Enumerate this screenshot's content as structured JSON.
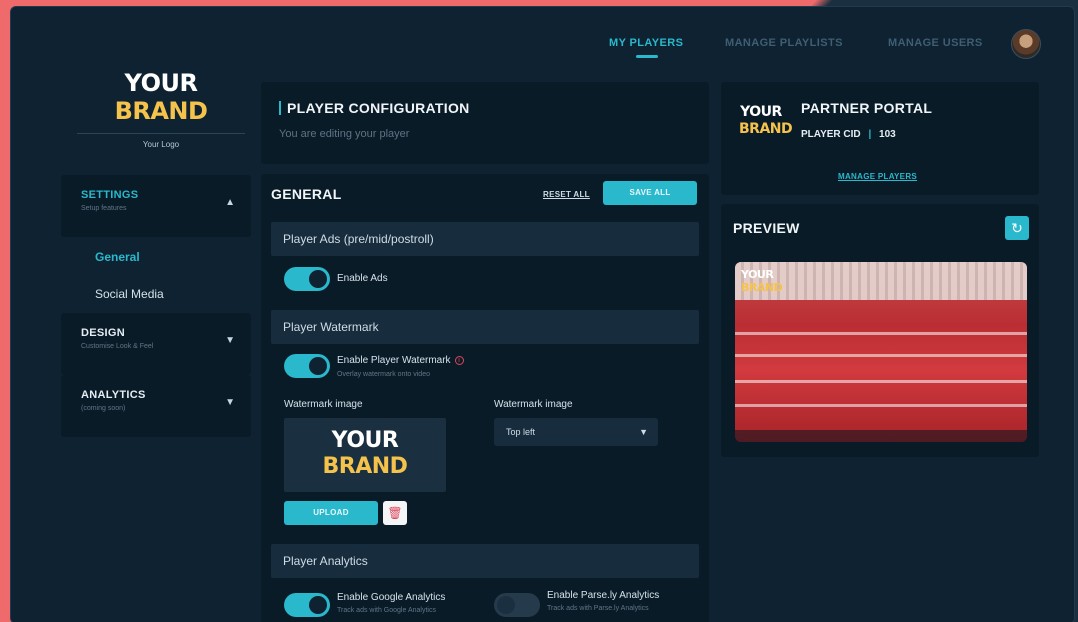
{
  "nav": {
    "tabs": [
      {
        "label": "MY PLAYERS",
        "active": true
      },
      {
        "label": "MANAGE PLAYLISTS",
        "active": false
      },
      {
        "label": "MANAGE USERS",
        "active": false
      }
    ]
  },
  "brand": {
    "line1": "YOUR",
    "line2": "BRAND",
    "caption": "Your Logo"
  },
  "sidebar": {
    "settings": {
      "title": "SETTINGS",
      "subtitle": "Setup features",
      "chevron": "▲"
    },
    "items": [
      {
        "label": "General",
        "active": true
      },
      {
        "label": "Social Media",
        "active": false
      }
    ],
    "design": {
      "title": "DESIGN",
      "subtitle": "Customise Look & Feel",
      "chevron": "▼"
    },
    "analytics": {
      "title": "ANALYTICS",
      "subtitle": "(coming soon)",
      "chevron": "▼"
    }
  },
  "config": {
    "title": "PLAYER CONFIGURATION",
    "subtitle": "You are editing your player"
  },
  "general": {
    "title": "GENERAL",
    "reset_label": "RESET ALL",
    "save_label": "SAVE ALL",
    "ads": {
      "section": "Player Ads (pre/mid/postroll)",
      "toggle_label": "Enable Ads",
      "enabled": true
    },
    "watermark": {
      "section": "Player Watermark",
      "toggle_label": "Enable Player Watermark",
      "toggle_sub": "Overlay watermark onto video",
      "enabled": true,
      "image_label": "Watermark image",
      "position_label": "Watermark image",
      "position_value": "Top left",
      "preview_line1": "YOUR",
      "preview_line2": "BRAND",
      "upload_label": "UPLOAD"
    },
    "analytics": {
      "section": "Player Analytics",
      "google_label": "Enable Google Analytics",
      "google_sub": "Track ads with Google Analytics",
      "google_enabled": true,
      "parsely_label": "Enable Parse.ly Analytics",
      "parsely_sub": "Track ads with Parse.ly Analytics",
      "parsely_enabled": false
    }
  },
  "partner": {
    "logo_line1": "YOUR",
    "logo_line2": "BRAND",
    "title": "PARTNER PORTAL",
    "cid_label": "PLAYER CID",
    "cid_value": "103",
    "manage_link": "MANAGE PLAYERS"
  },
  "preview": {
    "title": "PREVIEW",
    "watermark_line1": "YOUR",
    "watermark_line2": "BRAND"
  },
  "colors": {
    "accent": "#2ab8cc",
    "brand_yellow": "#f5c34b",
    "danger": "#e0455a",
    "panel_bg": "#0a1b28",
    "page_bg": "#0e2232"
  }
}
